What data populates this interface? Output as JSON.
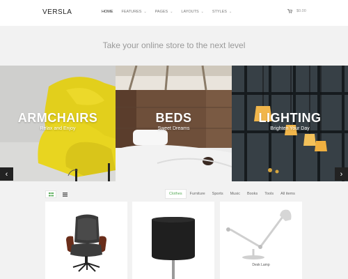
{
  "header": {
    "logo": "VERSLA",
    "nav": [
      {
        "label": "Home",
        "dropdown": false,
        "active": true
      },
      {
        "label": "Features",
        "dropdown": true
      },
      {
        "label": "Pages",
        "dropdown": true
      },
      {
        "label": "Layouts",
        "dropdown": true
      },
      {
        "label": "Styles",
        "dropdown": true
      }
    ],
    "cart_icon": "shopping-cart-icon",
    "cart_amount": "$0.00"
  },
  "tagline": "Take your online store to the next level",
  "slider": {
    "panels": [
      {
        "title": "ARMCHAIRS",
        "subtitle": "Relax and Enjoy"
      },
      {
        "title": "BEDS",
        "subtitle": "Sweet Dreams"
      },
      {
        "title": "LIGHTING",
        "subtitle": "Brighten Your Day"
      }
    ],
    "prev_icon": "chevron-left-icon",
    "next_icon": "chevron-right-icon"
  },
  "filters": {
    "view_icons": [
      "grid-view-icon",
      "list-view-icon"
    ],
    "categories": [
      "Clothes",
      "Furniture",
      "Sports",
      "Music",
      "Books",
      "Tools",
      "All items"
    ],
    "active_category": "Clothes"
  },
  "products": [
    {
      "name": ""
    },
    {
      "name": ""
    },
    {
      "name": "Desk Lamp"
    }
  ],
  "colors": {
    "accent": "#55aa55",
    "armchair_yellow": "#e8d21a",
    "arrow_bg": "#222222"
  }
}
